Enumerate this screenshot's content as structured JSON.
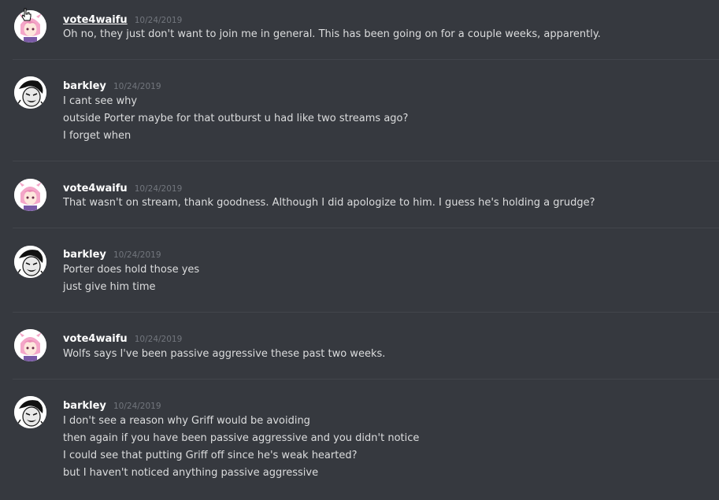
{
  "messages": [
    {
      "author": "vote4waifu",
      "avatar": "pink-hair-anime-avatar",
      "timestamp": "10/24/2019",
      "lines": [
        "Oh no, they just don't want to join me in general. This has been going on for a couple weeks, apparently."
      ]
    },
    {
      "author": "barkley",
      "avatar": "manga-face-avatar",
      "timestamp": "10/24/2019",
      "lines": [
        "I cant see why",
        "outside Porter maybe for that outburst u had like two streams ago?",
        "I forget when"
      ]
    },
    {
      "author": "vote4waifu",
      "avatar": "pink-hair-anime-avatar",
      "timestamp": "10/24/2019",
      "lines": [
        "That wasn't on stream, thank goodness. Although I did apologize to him. I guess he's holding a grudge?"
      ]
    },
    {
      "author": "barkley",
      "avatar": "manga-face-avatar",
      "timestamp": "10/24/2019",
      "lines": [
        "Porter does hold those yes",
        "just give him time"
      ]
    },
    {
      "author": "vote4waifu",
      "avatar": "pink-hair-anime-avatar",
      "timestamp": "10/24/2019",
      "lines": [
        "Wolfs says I've been passive aggressive these past two weeks."
      ]
    },
    {
      "author": "barkley",
      "avatar": "manga-face-avatar",
      "timestamp": "10/24/2019",
      "lines": [
        "I don't see a reason why Griff would be avoiding",
        "then again if you have been passive aggressive and you didn't notice",
        "I could see that putting Griff off since he's weak hearted?",
        "but I haven't noticed anything passive aggressive"
      ]
    }
  ],
  "colors": {
    "background": "#36393f",
    "author": "#ffffff",
    "timestamp": "#72767d",
    "text": "#dcddde",
    "divider": "#42454c"
  }
}
